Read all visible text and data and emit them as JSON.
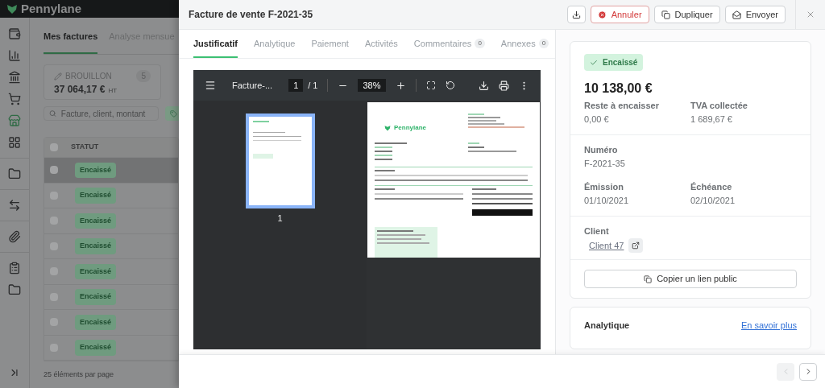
{
  "app": {
    "logo": "Pennylane",
    "tabs": [
      {
        "label": "Mes factures",
        "selected": true
      },
      {
        "label": "Analyse mensue",
        "selected": false
      }
    ],
    "summary_card": {
      "label": "BROUILLON",
      "count": "5",
      "amount": "37 064,17 €",
      "unit": "HT"
    },
    "search": {
      "placeholder": "Facture, client, montant"
    },
    "table": {
      "columns": [
        "STATUT"
      ],
      "header_checked": false,
      "rows": [
        {
          "status": "Encaissé",
          "selected": true,
          "checked": false
        },
        {
          "status": "Encaissé",
          "selected": false,
          "checked": false
        },
        {
          "status": "Encaissé",
          "selected": false,
          "checked": false
        },
        {
          "status": "Encaissé",
          "selected": false,
          "checked": false
        },
        {
          "status": "Encaissé",
          "selected": false,
          "checked": false
        },
        {
          "status": "Encaissé",
          "selected": false,
          "checked": false
        },
        {
          "status": "Encaissé",
          "selected": false,
          "checked": false
        },
        {
          "status": "Encaissé",
          "selected": false,
          "checked": false
        }
      ]
    },
    "footer": "25 éléments par page"
  },
  "drawer": {
    "title": "Facture de vente F-2021-35",
    "actions": [
      {
        "kind": "download"
      },
      {
        "kind": "danger",
        "label": "Annuler"
      },
      {
        "kind": "copy",
        "label": "Dupliquer"
      },
      {
        "kind": "send",
        "label": "Envoyer"
      }
    ],
    "tabs": [
      {
        "label": "Justificatif",
        "selected": true
      },
      {
        "label": "Analytique",
        "selected": false
      },
      {
        "label": "Paiement",
        "selected": false
      },
      {
        "label": "Activités",
        "selected": false
      },
      {
        "label": "Commentaires",
        "count": "0",
        "selected": false
      },
      {
        "label": "Annexes",
        "count": "0",
        "selected": false
      }
    ],
    "viewer": {
      "file": "Facture-...",
      "page": "1",
      "pages": "/ 1",
      "zoom": "38%",
      "thumbnail_label": "1",
      "document": {
        "logo": "Pennylane"
      }
    },
    "summary": {
      "status": "Encaissé",
      "total": "10 138,00 €",
      "amounts": [
        {
          "label": "Reste à encaisser",
          "value": "0,00 €"
        },
        {
          "label": "TVA collectée",
          "value": "1 689,67 €"
        }
      ],
      "number": {
        "label": "Numéro",
        "value": "F-2021-35"
      },
      "dates": [
        {
          "label": "Émission",
          "value": "01/10/2021"
        },
        {
          "label": "Échéance",
          "value": "02/10/2021"
        }
      ],
      "client": {
        "label": "Client",
        "value": "Client 47"
      },
      "copy_button": "Copier un lien public"
    },
    "analytics": {
      "title": "Analytique",
      "link": "En savoir plus"
    },
    "pagination": [
      {
        "kind": "prev",
        "disabled": true
      },
      {
        "kind": "next",
        "disabled": false
      }
    ]
  }
}
